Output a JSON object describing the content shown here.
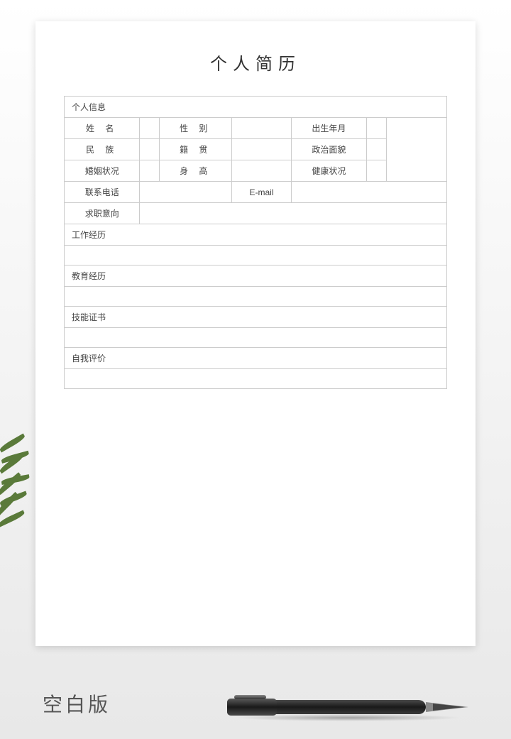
{
  "title": "个人简历",
  "sections": {
    "personal_info": "个人信息",
    "work_experience": "工作经历",
    "education": "教育经历",
    "skills": "技能证书",
    "self_evaluation": "自我评价"
  },
  "fields": {
    "name": "姓  名",
    "gender": "性  别",
    "birth": "出生年月",
    "ethnicity": "民  族",
    "origin": "籍  贯",
    "political": "政治面貌",
    "marital": "婚姻状况",
    "height": "身  高",
    "health": "健康状况",
    "phone": "联系电话",
    "email": "E-mail",
    "job_intention": "求职意向"
  },
  "values": {
    "name": "",
    "gender": "",
    "birth": "",
    "ethnicity": "",
    "origin": "",
    "political": "",
    "marital": "",
    "height": "",
    "health": "",
    "phone": "",
    "email": "",
    "job_intention": "",
    "work_experience": "",
    "education": "",
    "skills": "",
    "self_evaluation": ""
  },
  "footer": "空白版"
}
